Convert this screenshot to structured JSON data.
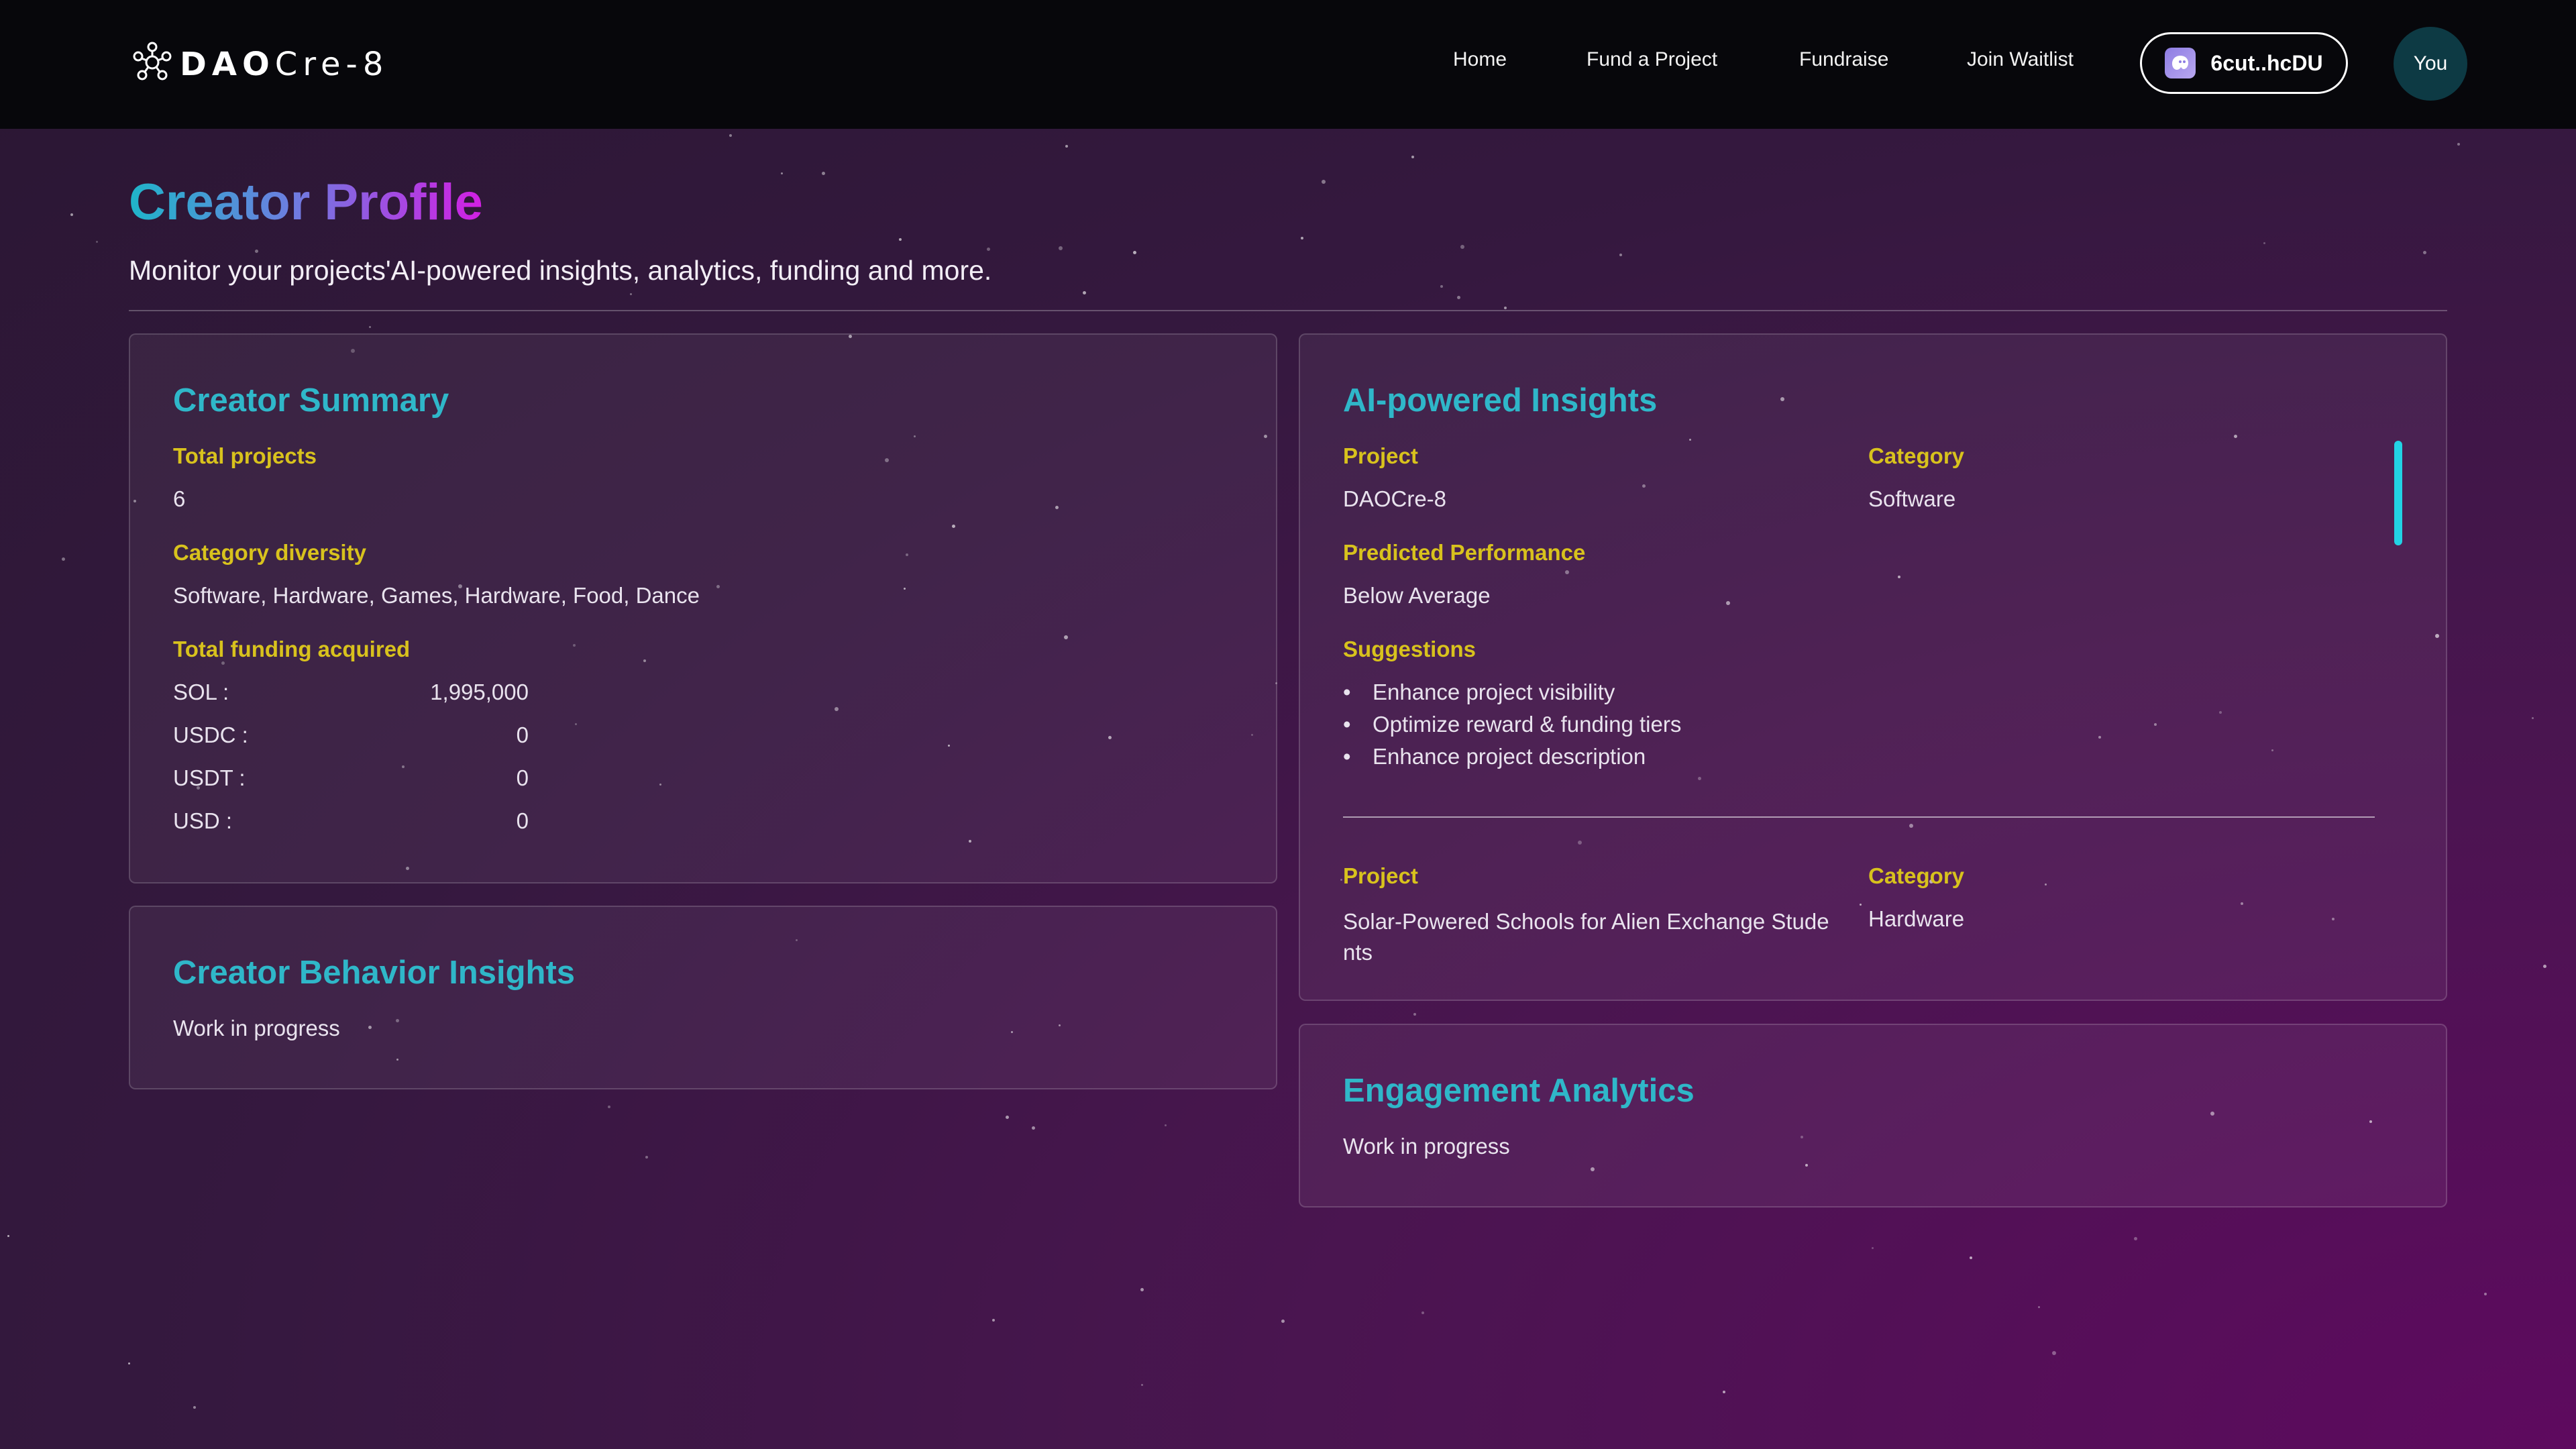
{
  "nav": {
    "logo_bold": "DAO",
    "logo_light": "Cre-8",
    "links": [
      "Home",
      "Fund a Project",
      "Fundraise",
      "Join Waitlist"
    ],
    "wallet_label": "6cut..hcDU",
    "avatar_label": "You"
  },
  "page": {
    "title": "Creator Profile",
    "subtitle": "Monitor your projects'AI-powered insights, analytics, funding and more."
  },
  "creator_summary": {
    "title": "Creator Summary",
    "total_projects_label": "Total projects",
    "total_projects": "6",
    "category_diversity_label": "Category diversity",
    "category_diversity": "Software, Hardware, Games, Hardware, Food, Dance",
    "total_funding_label": "Total funding acquired",
    "funding": [
      {
        "currency": "SOL :",
        "amount": "1,995,000"
      },
      {
        "currency": "USDC :",
        "amount": "0"
      },
      {
        "currency": "USDT :",
        "amount": "0"
      },
      {
        "currency": "USD :",
        "amount": "0"
      }
    ]
  },
  "behavior_insights": {
    "title": "Creator Behavior Insights",
    "status": "Work in progress"
  },
  "ai_insights": {
    "title": "AI-powered Insights",
    "project_label": "Project",
    "category_label": "Category",
    "performance_label": "Predicted Performance",
    "suggestions_label": "Suggestions",
    "projects": [
      {
        "name": "DAOCre-8",
        "category": "Software",
        "performance": "Below Average",
        "suggestions": [
          "Enhance project visibility",
          "Optimize reward & funding tiers",
          "Enhance project description"
        ]
      },
      {
        "name": "Solar-Powered Schools for Alien Exchange Students",
        "category": "Hardware"
      }
    ]
  },
  "engagement": {
    "title": "Engagement Analytics",
    "status": "Work in progress"
  },
  "colors": {
    "accent_teal": "#2fb7c9",
    "label_yellow": "#d8c21d",
    "scroll_cyan": "#22d3e4",
    "title_gradient_end": "#d21fe3"
  },
  "icons": {
    "logo": "molecule-logo-icon",
    "wallet": "ghost-wallet-icon"
  }
}
